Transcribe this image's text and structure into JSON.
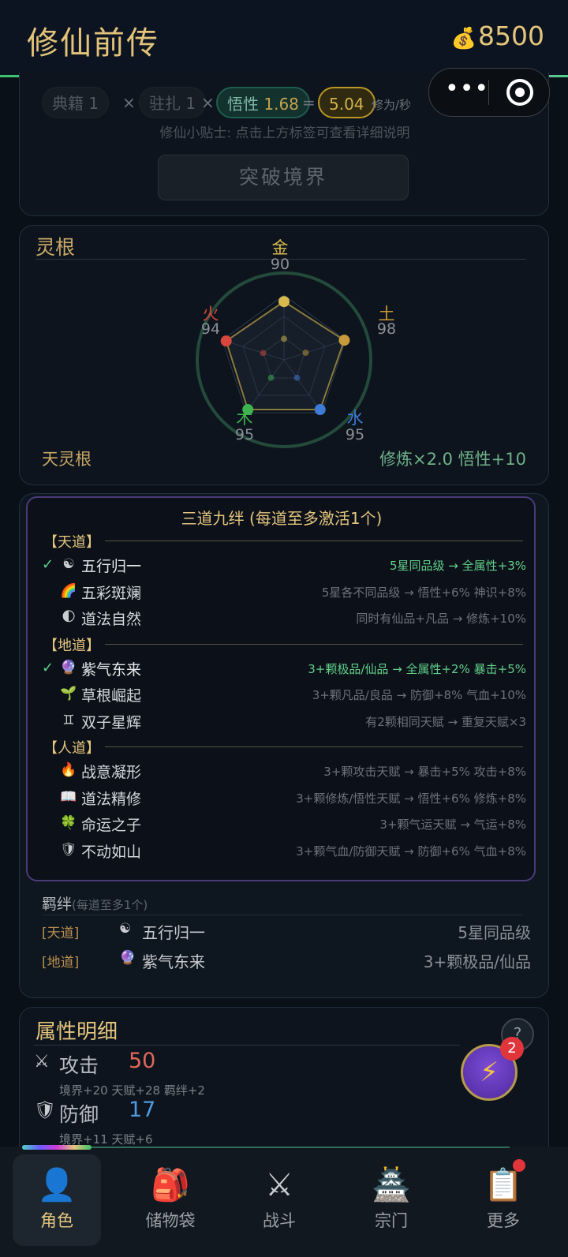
{
  "header": {
    "title": "修仙前传",
    "coins": "8500",
    "coin_icon": "money-bag-icon"
  },
  "breakthrough": {
    "formula": {
      "dianji": "典籍 1",
      "zhuzha": "驻扎 1",
      "wuxing_label": "悟性",
      "wuxing_value": "1.68",
      "result": "5.04",
      "unit": "修为/秒",
      "times": "×",
      "equals": "="
    },
    "tip": "修仙小贴士: 点击上方标签可查看详细说明",
    "button": "突破境界"
  },
  "spirit_root": {
    "title": "灵根",
    "elements": [
      {
        "name": "金",
        "value": "90",
        "color": "#d7b94e"
      },
      {
        "name": "土",
        "value": "98",
        "color": "#c89a3a"
      },
      {
        "name": "水",
        "value": "95",
        "color": "#3d7bd6"
      },
      {
        "name": "木",
        "value": "95",
        "color": "#3fb34f"
      },
      {
        "name": "火",
        "value": "94",
        "color": "#d9463b"
      }
    ],
    "type": "天灵根",
    "bonus": "修炼×2.0  悟性+10"
  },
  "bonds": {
    "title": "三道九绊 (每道至多激活1个)",
    "groups": [
      {
        "name": "【天道】",
        "items": [
          {
            "check": "✓",
            "icon": "☯",
            "name": "五行归一",
            "desc": "5星同品级 → 全属性+3%",
            "active": true
          },
          {
            "check": "",
            "icon": "🌈",
            "name": "五彩斑斓",
            "desc": "5星各不同品级 → 悟性+6% 神识+8%",
            "active": false
          },
          {
            "check": "",
            "icon": "🌓",
            "name": "道法自然",
            "desc": "同时有仙品+凡品 → 修炼+10%",
            "active": false
          }
        ]
      },
      {
        "name": "【地道】",
        "items": [
          {
            "check": "✓",
            "icon": "🔮",
            "name": "紫气东来",
            "desc": "3+颗极品/仙品 → 全属性+2% 暴击+5%",
            "active": true
          },
          {
            "check": "",
            "icon": "🌱",
            "name": "草根崛起",
            "desc": "3+颗凡品/良品 → 防御+8% 气血+10%",
            "active": false
          },
          {
            "check": "",
            "icon": "♊",
            "name": "双子星辉",
            "desc": "有2颗相同天赋 → 重复天赋×3",
            "active": false
          }
        ]
      },
      {
        "name": "【人道】",
        "items": [
          {
            "check": "",
            "icon": "🔥",
            "name": "战意凝形",
            "desc": "3+颗攻击天赋 → 暴击+5% 攻击+8%",
            "active": false
          },
          {
            "check": "",
            "icon": "📖",
            "name": "道法精修",
            "desc": "3+颗修炼/悟性天赋 → 悟性+6% 修炼+8%",
            "active": false
          },
          {
            "check": "",
            "icon": "🍀",
            "name": "命运之子",
            "desc": "3+颗气运天赋 → 气运+8%",
            "active": false
          },
          {
            "check": "",
            "icon": "🛡",
            "name": "不动如山",
            "desc": "3+颗气血/防御天赋 → 防御+6% 气血+8%",
            "active": false
          }
        ]
      }
    ],
    "active_title": "羁绊",
    "active_subtitle": "(每道至多1个)",
    "active": [
      {
        "tag": "[天道]",
        "icon": "☯",
        "name": "五行归一",
        "cond": "5星同品级"
      },
      {
        "tag": "[地道]",
        "icon": "🔮",
        "name": "紫气东来",
        "cond": "3+颗极品/仙品"
      }
    ]
  },
  "attributes": {
    "title": "属性明细",
    "help": "?",
    "items": [
      {
        "icon": "⚔",
        "name": "攻击",
        "value": "50",
        "color": "#e2665a",
        "detail": "境界+20  天赋+28  羁绊+2"
      },
      {
        "icon": "🛡",
        "name": "防御",
        "value": "17",
        "color": "#4e9be0",
        "detail": "境界+11  天赋+6"
      }
    ]
  },
  "fab": {
    "icon": "⚡",
    "badge": "2"
  },
  "nav": [
    {
      "icon": "👤",
      "label": "角色",
      "active": true
    },
    {
      "icon": "🎒",
      "label": "储物袋",
      "active": false
    },
    {
      "icon": "⚔",
      "label": "战斗",
      "active": false
    },
    {
      "icon": "🏯",
      "label": "宗门",
      "active": false
    },
    {
      "icon": "📋",
      "label": "更多",
      "active": false,
      "dot": true
    }
  ]
}
